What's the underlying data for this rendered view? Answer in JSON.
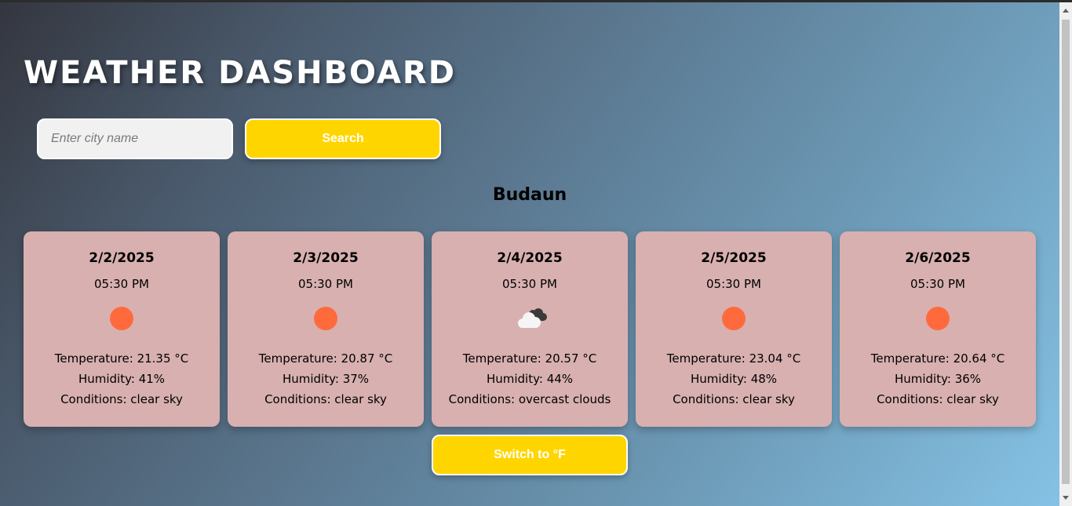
{
  "header": {
    "title": "WEATHER DASHBOARD"
  },
  "search": {
    "placeholder": "Enter city name",
    "value": "",
    "button_label": "Search"
  },
  "city": "Budaun",
  "forecast": [
    {
      "date": "2/2/2025",
      "time": "05:30 PM",
      "icon": "sun-icon",
      "temperature": "Temperature: 21.35 °C",
      "humidity": "Humidity: 41%",
      "conditions": "Conditions: clear sky"
    },
    {
      "date": "2/3/2025",
      "time": "05:30 PM",
      "icon": "sun-icon",
      "temperature": "Temperature: 20.87 °C",
      "humidity": "Humidity: 37%",
      "conditions": "Conditions: clear sky"
    },
    {
      "date": "2/4/2025",
      "time": "05:30 PM",
      "icon": "overcast-clouds-icon",
      "temperature": "Temperature: 20.57 °C",
      "humidity": "Humidity: 44%",
      "conditions": "Conditions: overcast clouds"
    },
    {
      "date": "2/5/2025",
      "time": "05:30 PM",
      "icon": "sun-icon",
      "temperature": "Temperature: 23.04 °C",
      "humidity": "Humidity: 48%",
      "conditions": "Conditions: clear sky"
    },
    {
      "date": "2/6/2025",
      "time": "05:30 PM",
      "icon": "sun-icon",
      "temperature": "Temperature: 20.64 °C",
      "humidity": "Humidity: 36%",
      "conditions": "Conditions: clear sky"
    }
  ],
  "unit_toggle": {
    "label": "Switch to °F"
  },
  "colors": {
    "accent_button": "#ffd500",
    "card_background": "#d8b0b0",
    "sun": "#ff6a3d"
  }
}
